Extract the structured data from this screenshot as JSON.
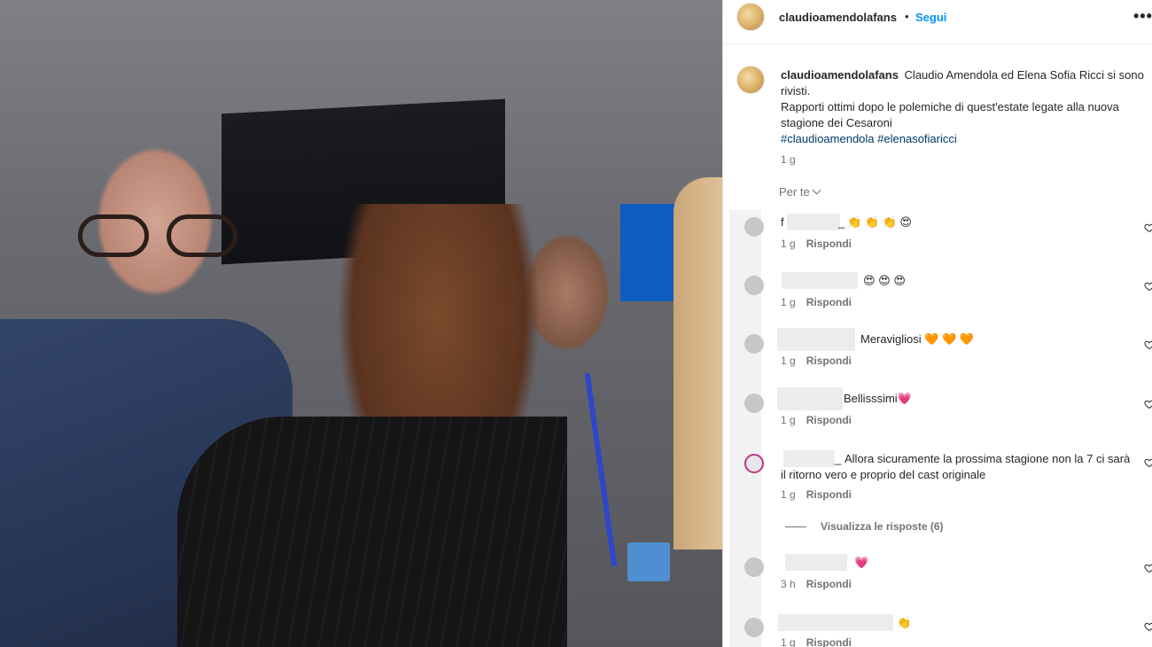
{
  "post": {
    "username": "claudioamendolafans",
    "separator": "•",
    "follow_label": "Segui",
    "more_label": "•••"
  },
  "caption": {
    "username": "claudioamendolafans",
    "text_line1": "Claudio Amendola ed Elena Sofia Ricci si sono rivisti.",
    "text_line2": "Rapporti ottimi dopo le polemiche di quest'estate legate alla nuova stagione dei Cesaroni",
    "hashtags": [
      "#claudioamendola",
      "#elenasofiaricci"
    ],
    "time": "1 g"
  },
  "comments_header": {
    "label": "Per te"
  },
  "comments": [
    {
      "user_visible": "f",
      "user_suffix": "_",
      "text": "👏 👏 👏 😍",
      "time": "1 g",
      "reply_label": "Rispondi"
    },
    {
      "user_visible": "",
      "user_suffix": "",
      "text": "😍 😍 😍",
      "time": "1 g",
      "reply_label": "Rispondi"
    },
    {
      "user_visible": "",
      "user_suffix": "",
      "text": "Meravigliosi 🧡 🧡 🧡",
      "time": "1 g",
      "reply_label": "Rispondi"
    },
    {
      "user_visible": "",
      "user_suffix": "",
      "text": "Bellisssimi💗",
      "time": "1 g",
      "reply_label": "Rispondi"
    },
    {
      "user_visible": "",
      "user_suffix": "_",
      "text": "Allora sicuramente la prossima stagione non la 7 ci sarà il ritorno vero e proprio del cast originale",
      "time": "1 g",
      "reply_label": "Rispondi"
    },
    {
      "user_visible": "",
      "user_suffix": "",
      "text": "💗",
      "time": "3 h",
      "reply_label": "Rispondi"
    },
    {
      "user_visible": "",
      "user_suffix": "",
      "text": "👏",
      "time": "1 g",
      "reply_label": "Rispondi"
    }
  ],
  "view_replies": {
    "label": "Visualizza le risposte (6)"
  },
  "icons": {
    "heart": "heart-outline-icon",
    "chevron": "chevron-down-icon",
    "more": "more-horizontal-icon"
  },
  "colors": {
    "link": "#0095f6",
    "hashtag": "#00376b",
    "muted": "#737373",
    "text": "#262626"
  }
}
